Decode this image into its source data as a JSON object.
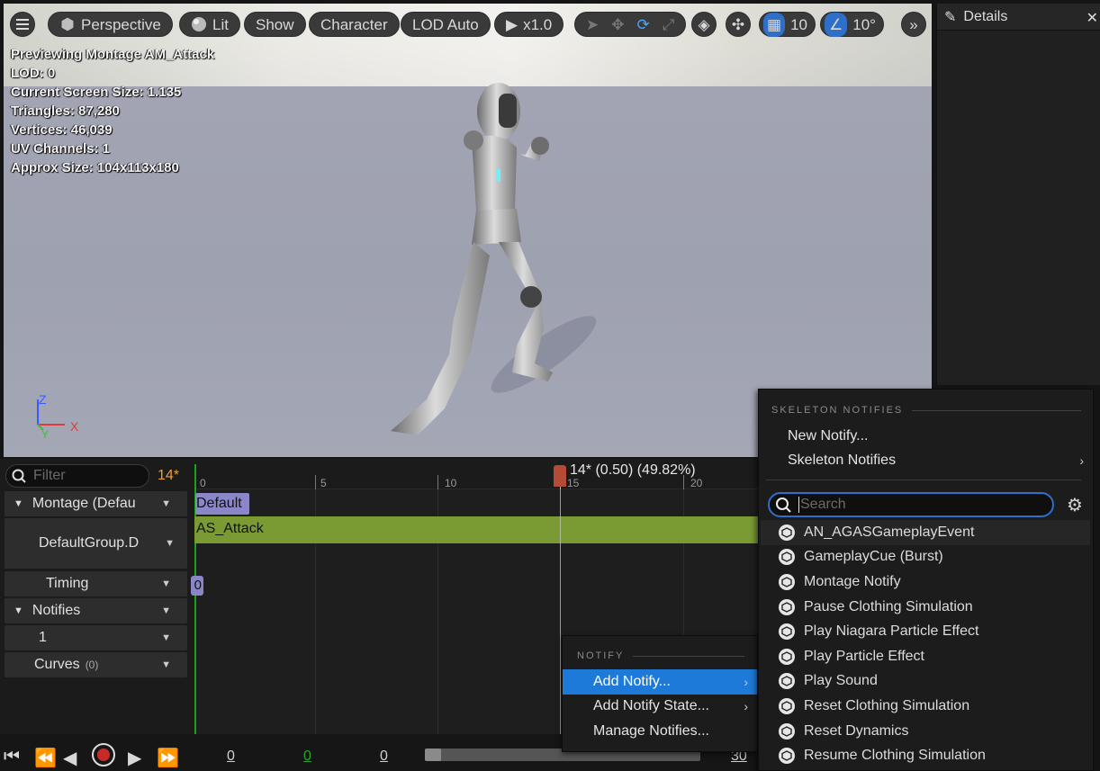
{
  "viewport": {
    "toolbar": {
      "perspective": "Perspective",
      "lit": "Lit",
      "show": "Show",
      "character": "Character",
      "lod": "LOD Auto",
      "speed": "x1.0",
      "grid_snap": "10",
      "rotation_snap": "10°"
    },
    "stats": [
      "Previewing Montage AM_Attack",
      "LOD: 0",
      "Current Screen Size: 1.135",
      "Triangles: 87,280",
      "Vertices: 46,039",
      "UV Channels: 1",
      "Approx Size: 104x113x180"
    ],
    "axis": {
      "z": "Z",
      "x": "X",
      "y": "Y"
    }
  },
  "details": {
    "title": "Details"
  },
  "timeline": {
    "filter_placeholder": "Filter",
    "frame_count": "14*",
    "tracks": {
      "montage": "Montage (Defau",
      "group": "DefaultGroup.D",
      "timing": "Timing",
      "notifies": "Notifies",
      "notify_track": "1",
      "curves": "Curves",
      "curves_count": "(0)"
    },
    "ruler": {
      "t0": "0",
      "t5": "5",
      "t10": "10",
      "t15": "15",
      "t20": "20"
    },
    "playhead_label": "14* (0.50) (49.82%)",
    "section_label": "Default",
    "segment_label": "AS_Attack",
    "timing_marker": "0",
    "bottom": {
      "start": "0",
      "current": "0",
      "end": "0",
      "total": "30"
    }
  },
  "menu_notify": {
    "section": "NOTIFY",
    "items": [
      "Add Notify...",
      "Add Notify State...",
      "Manage Notifies..."
    ]
  },
  "menu_skeleton": {
    "section": "SKELETON NOTIFIES",
    "new_notify": "New Notify...",
    "skeleton_notifies": "Skeleton Notifies",
    "search_placeholder": "Search",
    "items": [
      "AN_AGASGameplayEvent",
      "GameplayCue (Burst)",
      "Montage Notify",
      "Pause Clothing Simulation",
      "Play Niagara Particle Effect",
      "Play Particle Effect",
      "Play Sound",
      "Reset Clothing Simulation",
      "Reset Dynamics",
      "Resume Clothing Simulation"
    ]
  },
  "colors": {
    "accent": "#1e7ad8",
    "segment_green": "#7a9a34",
    "frame_orange": "#e8a13a",
    "playhead": "#b54a36",
    "section_purple": "#8a86c8"
  }
}
